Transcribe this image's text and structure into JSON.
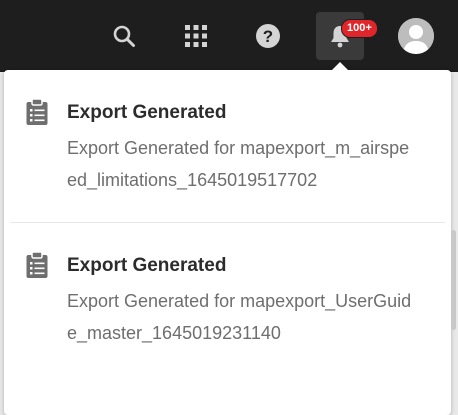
{
  "header": {
    "icons": [
      "search-icon",
      "apps-grid-icon",
      "help-icon",
      "bell-icon",
      "avatar-icon"
    ],
    "notification_badge": "100+",
    "colors": {
      "bar": "#1e1e1e",
      "badge": "#e0262a",
      "icon": "#d4d4d4"
    }
  },
  "notifications": [
    {
      "icon": "clipboard-icon",
      "title": "Export Generated",
      "body": "Export Generated for mapexport_m_airspeed_limitations_1645019517702"
    },
    {
      "icon": "clipboard-icon",
      "title": "Export Generated",
      "body": "Export Generated for mapexport_UserGuide_master_1645019231140"
    }
  ]
}
